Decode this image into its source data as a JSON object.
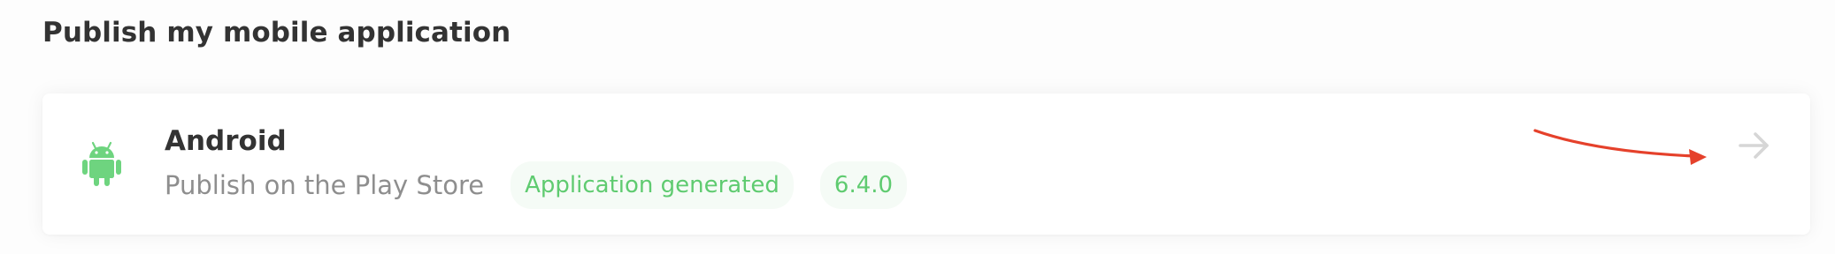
{
  "section": {
    "title": "Publish my mobile application"
  },
  "platforms": [
    {
      "name": "Android",
      "icon": "android-icon",
      "subtitle": "Publish on the Play Store",
      "status": "Application generated",
      "version": "6.4.0",
      "action_icon": "arrow-right-icon"
    }
  ],
  "colors": {
    "android_green": "#6ed47f",
    "badge_text": "#5fcb70",
    "badge_bg": "#f5fbf6",
    "annotation_red": "#e5412b",
    "arrow_gray": "#d6d6d6"
  }
}
